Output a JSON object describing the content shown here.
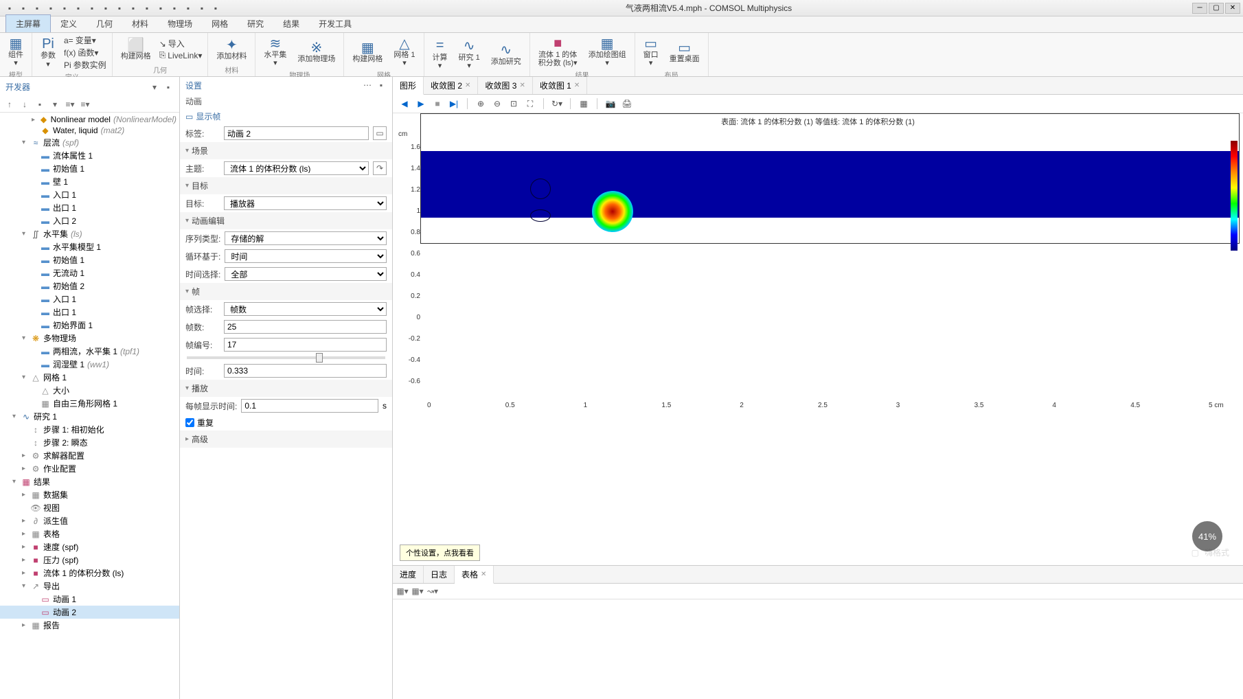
{
  "title": "气液两相流V5.4.mph - COMSOL Multiphysics",
  "qat_icons": [
    "file-icon",
    "save-icon",
    "undo-icon",
    "redo-icon",
    "play-icon",
    "back-icon",
    "fwd-icon",
    "refresh-icon",
    "copy-icon",
    "paste-icon",
    "cut-icon",
    "grid-icon",
    "delete-icon",
    "link-icon",
    "zoom-icon",
    "help-icon"
  ],
  "ribbon_tabs": [
    "主屏幕",
    "定义",
    "几何",
    "材料",
    "物理场",
    "网格",
    "研究",
    "结果",
    "开发工具"
  ],
  "ribbon_active": 0,
  "ribbon_groups": [
    {
      "label": "模型",
      "items": [
        {
          "icon": "▦",
          "label": "组件\n▾"
        }
      ]
    },
    {
      "label": "定义",
      "items": [
        {
          "icon": "Pi",
          "label": "参数\n▾"
        }
      ],
      "small": [
        {
          "icon": "a=",
          "text": "变量▾"
        },
        {
          "icon": "f(x)",
          "text": "函数▾"
        },
        {
          "icon": "Pi",
          "text": "参数实例"
        }
      ]
    },
    {
      "label": "几何",
      "items": [
        {
          "icon": "⬜",
          "label": "构建网格"
        }
      ],
      "small": [
        {
          "icon": "↘",
          "text": "导入"
        },
        {
          "icon": "⎘",
          "text": "LiveLink▾"
        }
      ]
    },
    {
      "label": "材料",
      "items": [
        {
          "icon": "✦",
          "label": "添加材料"
        }
      ]
    },
    {
      "label": "物理场",
      "items": [
        {
          "icon": "≋",
          "label": "水平集\n▾"
        },
        {
          "icon": "※",
          "label": "添加物理场"
        }
      ]
    },
    {
      "label": "网格",
      "items": [
        {
          "icon": "▦",
          "label": "构建网格"
        },
        {
          "icon": "△",
          "label": "网格 1\n▾"
        }
      ]
    },
    {
      "label": "",
      "items": [
        {
          "icon": "=",
          "label": "计算\n▾"
        },
        {
          "icon": "∿",
          "label": "研究 1\n▾"
        },
        {
          "icon": "∿",
          "label": "添加研究"
        }
      ]
    },
    {
      "label": "结果",
      "items": [
        {
          "icon": "■",
          "label": "流体 1 的体\n积分数 (ls)▾",
          "color": "#c04070"
        },
        {
          "icon": "▦",
          "label": "添加绘图组\n▾"
        }
      ]
    },
    {
      "label": "布局",
      "items": [
        {
          "icon": "▭",
          "label": "窗口\n▾"
        },
        {
          "icon": "▭",
          "label": "重置桌面"
        }
      ]
    }
  ],
  "developer": {
    "title": "开发器",
    "tree": [
      {
        "d": 3,
        "t": "▸",
        "i": "◆",
        "c": "#d89000",
        "l": "Nonlinear model",
        "s": "(NonlinearModel)"
      },
      {
        "d": 3,
        "t": "",
        "i": "◆",
        "c": "#d89000",
        "l": "Water, liquid",
        "s": "(mat2)"
      },
      {
        "d": 2,
        "t": "▾",
        "i": "≈",
        "c": "#3a6ea5",
        "l": "层流",
        "s": "(spf)"
      },
      {
        "d": 3,
        "t": "",
        "i": "▬",
        "c": "#5590cc",
        "l": "流体属性 1"
      },
      {
        "d": 3,
        "t": "",
        "i": "▬",
        "c": "#5590cc",
        "l": "初始值 1"
      },
      {
        "d": 3,
        "t": "",
        "i": "▬",
        "c": "#5590cc",
        "l": "壁 1"
      },
      {
        "d": 3,
        "t": "",
        "i": "▬",
        "c": "#5590cc",
        "l": "入口 1"
      },
      {
        "d": 3,
        "t": "",
        "i": "▬",
        "c": "#5590cc",
        "l": "出口 1"
      },
      {
        "d": 3,
        "t": "",
        "i": "▬",
        "c": "#5590cc",
        "l": "入口 2"
      },
      {
        "d": 2,
        "t": "▾",
        "i": "∬",
        "c": "#555",
        "l": "水平集",
        "s": "(ls)"
      },
      {
        "d": 3,
        "t": "",
        "i": "▬",
        "c": "#5590cc",
        "l": "水平集模型 1"
      },
      {
        "d": 3,
        "t": "",
        "i": "▬",
        "c": "#5590cc",
        "l": "初始值 1"
      },
      {
        "d": 3,
        "t": "",
        "i": "▬",
        "c": "#5590cc",
        "l": "无流动 1"
      },
      {
        "d": 3,
        "t": "",
        "i": "▬",
        "c": "#5590cc",
        "l": "初始值 2"
      },
      {
        "d": 3,
        "t": "",
        "i": "▬",
        "c": "#5590cc",
        "l": "入口 1"
      },
      {
        "d": 3,
        "t": "",
        "i": "▬",
        "c": "#5590cc",
        "l": "出口 1"
      },
      {
        "d": 3,
        "t": "",
        "i": "▬",
        "c": "#5590cc",
        "l": "初始界面 1"
      },
      {
        "d": 2,
        "t": "▾",
        "i": "❋",
        "c": "#d89000",
        "l": "多物理场"
      },
      {
        "d": 3,
        "t": "",
        "i": "▬",
        "c": "#5590cc",
        "l": "两相流，水平集 1",
        "s": "(tpf1)"
      },
      {
        "d": 3,
        "t": "",
        "i": "▬",
        "c": "#5590cc",
        "l": "润湿壁 1",
        "s": "(ww1)"
      },
      {
        "d": 2,
        "t": "▾",
        "i": "△",
        "c": "#888",
        "l": "网格 1"
      },
      {
        "d": 3,
        "t": "",
        "i": "△",
        "c": "#888",
        "l": "大小"
      },
      {
        "d": 3,
        "t": "",
        "i": "▦",
        "c": "#888",
        "l": "自由三角形网格 1"
      },
      {
        "d": 1,
        "t": "▾",
        "i": "∿",
        "c": "#3a6ea5",
        "l": "研究 1"
      },
      {
        "d": 2,
        "t": "",
        "i": "↕",
        "c": "#888",
        "l": "步骤 1: 相初始化"
      },
      {
        "d": 2,
        "t": "",
        "i": "↕",
        "c": "#888",
        "l": "步骤 2: 瞬态"
      },
      {
        "d": 2,
        "t": "▸",
        "i": "⚙",
        "c": "#888",
        "l": "求解器配置"
      },
      {
        "d": 2,
        "t": "▸",
        "i": "⚙",
        "c": "#888",
        "l": "作业配置"
      },
      {
        "d": 1,
        "t": "▾",
        "i": "▦",
        "c": "#c04070",
        "l": "结果"
      },
      {
        "d": 2,
        "t": "▸",
        "i": "▦",
        "c": "#888",
        "l": "数据集"
      },
      {
        "d": 2,
        "t": "",
        "i": "👁",
        "c": "#888",
        "l": "视图"
      },
      {
        "d": 2,
        "t": "▸",
        "i": "∂",
        "c": "#888",
        "l": "派生值"
      },
      {
        "d": 2,
        "t": "▸",
        "i": "▦",
        "c": "#888",
        "l": "表格"
      },
      {
        "d": 2,
        "t": "▸",
        "i": "■",
        "c": "#c04070",
        "l": "速度 (spf)"
      },
      {
        "d": 2,
        "t": "▸",
        "i": "■",
        "c": "#c04070",
        "l": "压力 (spf)"
      },
      {
        "d": 2,
        "t": "▸",
        "i": "■",
        "c": "#c04070",
        "l": "流体 1 的体积分数 (ls)"
      },
      {
        "d": 2,
        "t": "▾",
        "i": "↗",
        "c": "#888",
        "l": "导出"
      },
      {
        "d": 3,
        "t": "",
        "i": "▭",
        "c": "#c04070",
        "l": "动画 1"
      },
      {
        "d": 3,
        "t": "",
        "i": "▭",
        "c": "#c04070",
        "l": "动画 2",
        "sel": true
      },
      {
        "d": 2,
        "t": "▸",
        "i": "▦",
        "c": "#888",
        "l": "报告"
      }
    ]
  },
  "settings": {
    "title": "设置",
    "subtitle": "动画",
    "link": "显示帧",
    "label_field": {
      "label": "标签:",
      "value": "动画 2"
    },
    "sections": [
      {
        "name": "场景",
        "rows": [
          {
            "type": "select",
            "label": "主题:",
            "value": "流体 1 的体积分数 (ls)",
            "btn": true
          }
        ]
      },
      {
        "name": "目标",
        "rows": [
          {
            "type": "select",
            "label": "目标:",
            "value": "播放器"
          }
        ]
      },
      {
        "name": "动画编辑",
        "rows": [
          {
            "type": "select",
            "label": "序列类型:",
            "value": "存储的解"
          },
          {
            "type": "select",
            "label": "循环基于:",
            "value": "时间"
          },
          {
            "type": "select",
            "label": "时间选择:",
            "value": "全部"
          }
        ]
      },
      {
        "name": "帧",
        "rows": [
          {
            "type": "select",
            "label": "帧选择:",
            "value": "帧数"
          },
          {
            "type": "text",
            "label": "帧数:",
            "value": "25"
          },
          {
            "type": "text",
            "label": "帧编号:",
            "value": "17"
          },
          {
            "type": "slider",
            "pos": 65
          },
          {
            "type": "text",
            "label": "时间:",
            "value": "0.333"
          }
        ]
      },
      {
        "name": "播放",
        "rows": [
          {
            "type": "text",
            "label": "每帧显示时间:",
            "value": "0.1",
            "unit": "s"
          },
          {
            "type": "checkbox",
            "label": "重复",
            "checked": true
          }
        ]
      },
      {
        "name": "高级",
        "collapsed": true
      }
    ]
  },
  "graphics": {
    "tabs": [
      "图形",
      "收敛图 2",
      "收敛图 3",
      "收敛图 1"
    ],
    "active": 0,
    "plot_title": "表面: 流体 1 的体积分数 (1)  等值线: 流体 1 的体积分数 (1)",
    "y_unit": "cm",
    "x_unit": "cm",
    "y_ticks": [
      "1.6",
      "1.4",
      "1.2",
      "1",
      "0.8",
      "0.6",
      "0.4",
      "0.2",
      "0",
      "-0.2",
      "-0.4",
      "-0.6"
    ],
    "x_ticks": [
      "0",
      "0.5",
      "1",
      "1.5",
      "2",
      "2.5",
      "3",
      "3.5",
      "4",
      "4.5",
      "5"
    ]
  },
  "bottom": {
    "tabs": [
      "进度",
      "日志",
      "表格"
    ],
    "active": 2
  },
  "tooltip": "个性设置，点我看看",
  "percent": "41%",
  "watermark": "嗨格式"
}
